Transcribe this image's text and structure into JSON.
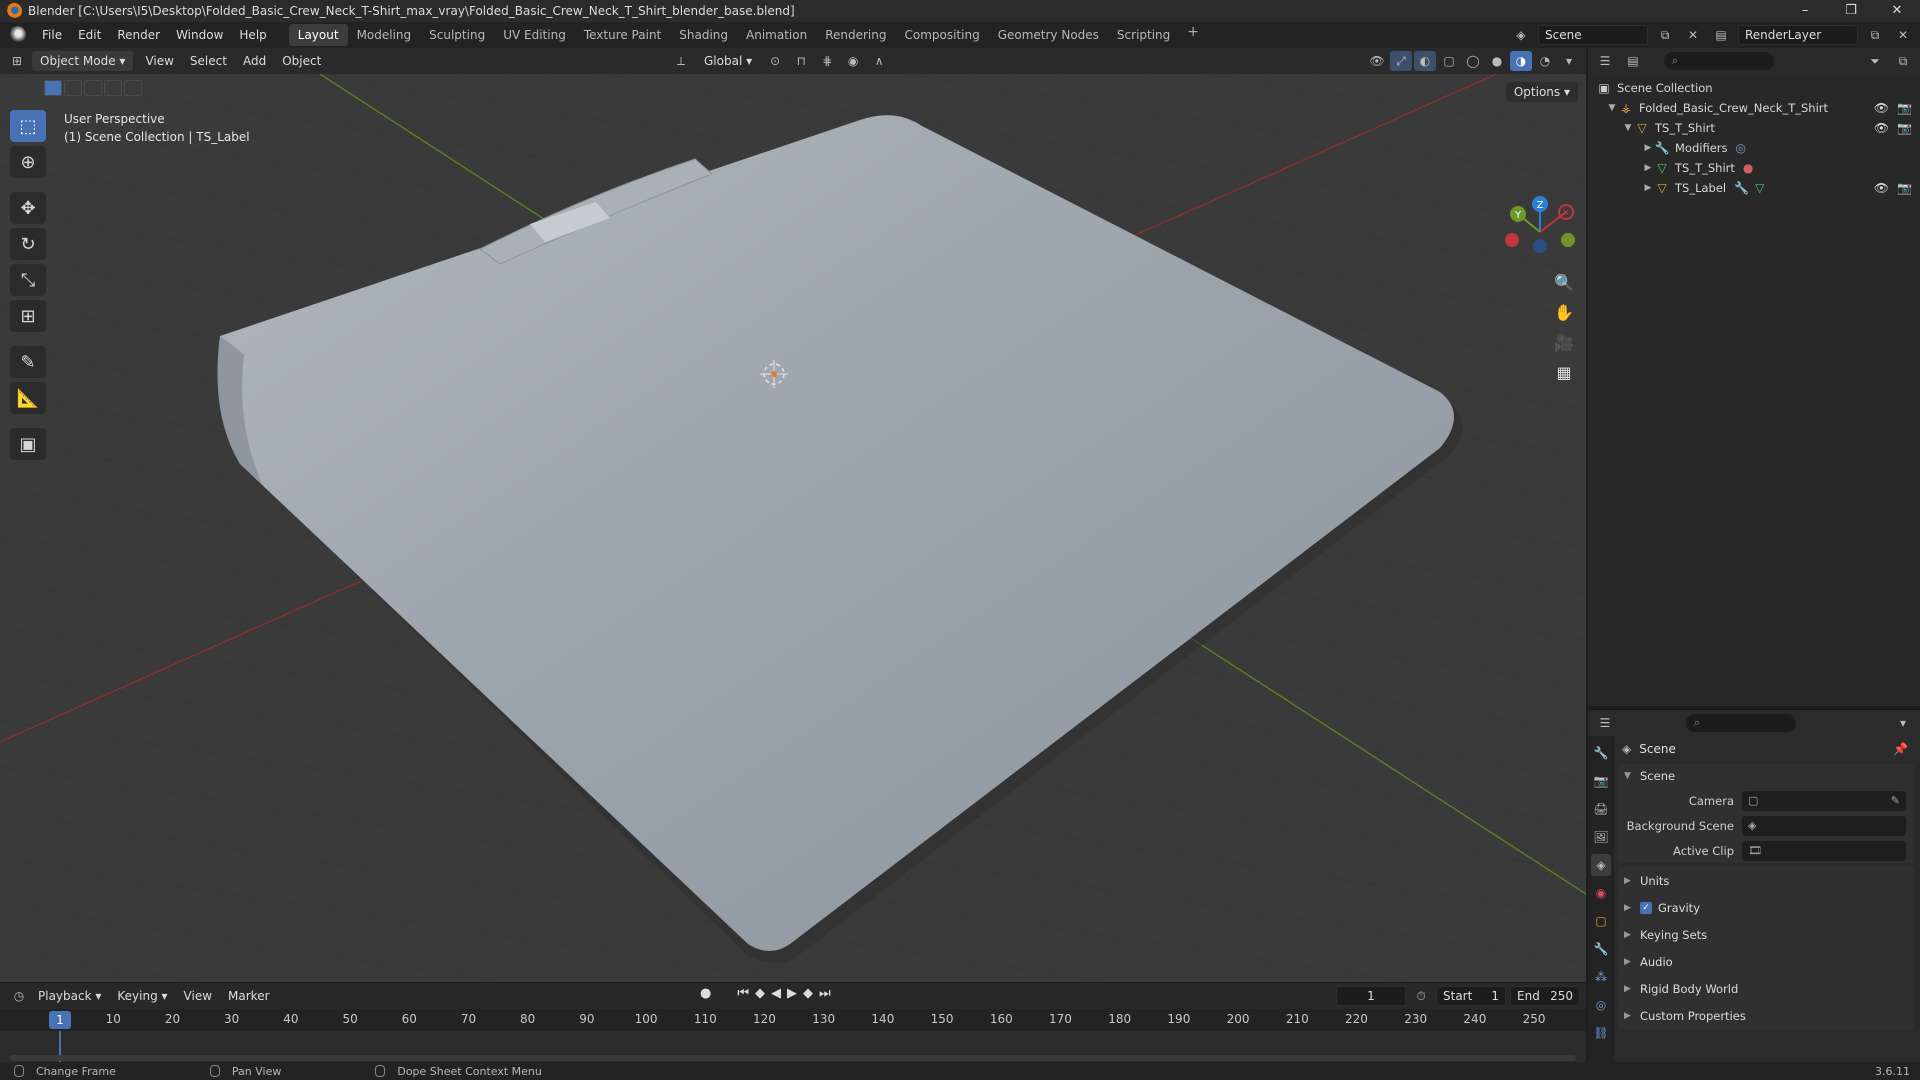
{
  "window": {
    "title": "Blender [C:\\Users\\I5\\Desktop\\Folded_Basic_Crew_Neck_T-Shirt_max_vray\\Folded_Basic_Crew_Neck_T_Shirt_blender_base.blend]",
    "minimize": "–",
    "maximize": "❐",
    "close": "✕"
  },
  "menu": [
    "File",
    "Edit",
    "Render",
    "Window",
    "Help"
  ],
  "workspaces": [
    "Layout",
    "Modeling",
    "Sculpting",
    "UV Editing",
    "Texture Paint",
    "Shading",
    "Animation",
    "Rendering",
    "Compositing",
    "Geometry Nodes",
    "Scripting"
  ],
  "workspace_add": "+",
  "active_workspace": "Layout",
  "scene_name": "Scene",
  "view_layer": "RenderLayer",
  "viewport_header": {
    "mode": "Object Mode",
    "menus": [
      "View",
      "Select",
      "Add",
      "Object"
    ],
    "transform_orientation": "Global",
    "options": "Options"
  },
  "viewport_info": {
    "perspective": "User Perspective",
    "collection": "(1) Scene Collection | TS_Label"
  },
  "gizmo": {
    "z": "Z",
    "y": "Y"
  },
  "outliner": {
    "rows": [
      {
        "label": "Scene Collection",
        "indent": 0,
        "icon": "collection-icon"
      },
      {
        "label": "Folded_Basic_Crew_Neck_T_Shirt",
        "indent": 1,
        "icon": "empty-icon"
      },
      {
        "label": "TS_T_Shirt",
        "indent": 2,
        "icon": "mesh-object-icon"
      },
      {
        "label": "Modifiers",
        "indent": 3,
        "icon": "wrench-icon"
      },
      {
        "label": "TS_T_Shirt",
        "indent": 3,
        "icon": "mesh-data-icon"
      },
      {
        "label": "TS_Label",
        "indent": 3,
        "icon": "mesh-object-icon"
      }
    ]
  },
  "properties": {
    "title": "Scene",
    "panel_scene": "Scene",
    "fields": [
      {
        "label": "Camera",
        "value": ""
      },
      {
        "label": "Background Scene",
        "value": ""
      },
      {
        "label": "Active Clip",
        "value": ""
      }
    ],
    "sections": [
      "Units",
      "Gravity",
      "Keying Sets",
      "Audio",
      "Rigid Body World",
      "Custom Properties"
    ],
    "gravity_checked": "✓"
  },
  "timeline": {
    "menus": [
      "Playback",
      "Keying",
      "View",
      "Marker"
    ],
    "current_frame": "1",
    "start_label": "Start",
    "start": "1",
    "end_label": "End",
    "end": "250",
    "ticks": [
      "1",
      "10",
      "20",
      "30",
      "40",
      "50",
      "60",
      "70",
      "80",
      "90",
      "100",
      "110",
      "120",
      "130",
      "140",
      "150",
      "160",
      "170",
      "180",
      "190",
      "200",
      "210",
      "220",
      "230",
      "240",
      "250"
    ]
  },
  "statusbar": {
    "items": [
      "Change Frame",
      "Pan View",
      "Dope Sheet Context Menu"
    ],
    "version": "3.6.11"
  },
  "colors": {
    "accent": "#4772b3",
    "x_axis": "#c03a3a",
    "y_axis": "#6a9a25",
    "shirt": "#9aa3ad"
  }
}
